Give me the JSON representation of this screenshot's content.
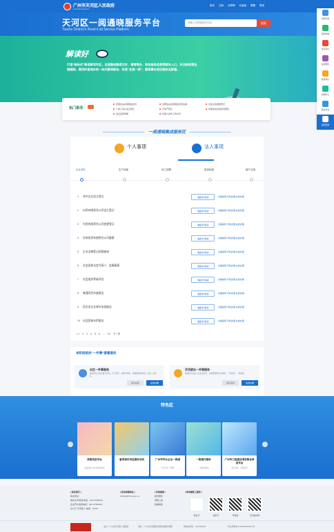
{
  "header": {
    "gov_name": "广州市天河区人民政府",
    "gov_sub": "www.thnet.gov.cn",
    "links": [
      "首页",
      "注册",
      "无障碍",
      "长者版",
      "繁體",
      "登录"
    ]
  },
  "hero": {
    "title": "天河区一阅通晓服务平台",
    "subtitle": "Tianhe District's  Read it all  Service Platform",
    "search_placeholder": "请输入您想搜索的内容",
    "search_button": "搜索"
  },
  "banner": {
    "badge": "解读好",
    "desc": "打造“新标式”解读事项专区，全面集成解读文件、请常等办、政务服务信息等服务入口，关注新政策全程跟踪、提供好查询办的一站式解读服务，实现“全程一网”，解读事办前后服务全都管。"
  },
  "hot": {
    "label": "热门事项",
    "items": [
      "存量住房买卖网签合同",
      "存量住房买卖网签合同注销",
      "企业社会保险登记",
      "个体工商户设立登记",
      "不动产登记",
      "存量住房买卖合同网签",
      "企业名称申报",
      "外国人来华工作许可"
    ]
  },
  "section": {
    "heading": "一阅通晓集成服务区",
    "tabs": [
      "个人事项",
      "法人事项"
    ],
    "steps": [
      "企业开办",
      "生产经营",
      "用工招聘",
      "投资经营",
      "破产注销"
    ]
  },
  "rows": [
    {
      "num": "1",
      "name": "合伙企业设立登记"
    },
    {
      "num": "2",
      "name": "内资有限责任公司设立登记"
    },
    {
      "num": "3",
      "name": "内资有限责任公司变更登记"
    },
    {
      "num": "4",
      "name": "外商投资有限责任公司备案"
    },
    {
      "num": "5",
      "name": "企业法律登记档案查询"
    },
    {
      "num": "6",
      "name": "社会团体法定代表人、监事备案"
    },
    {
      "num": "7",
      "name": "社会组织等级评估"
    },
    {
      "num": "8",
      "name": "普通项目年度报告"
    },
    {
      "num": "9",
      "name": "民办非企业单位年度报告"
    },
    {
      "num": "10",
      "name": "社会团体年检报告"
    }
  ],
  "row_labels": {
    "btn": "“做起式”解读",
    "acts": "办事指南  手机办理  在线办理"
  },
  "pager": [
    "< 1",
    "2",
    "3",
    "4",
    "5",
    "6",
    "...",
    "10",
    "下一页"
  ],
  "guide": {
    "title": "本阶段相关“一件事”套餐服务",
    "cards": [
      {
        "title": "出生一件事服务",
        "desc": "集成新生儿出生医学证明、户口登记、社保卡申领、医保参保等事项，实现一次办好。",
        "b1": "服务指南",
        "b2": "在线办理"
      },
      {
        "title": "灵活就业一件事服务",
        "desc": "集成灵活就业人员就业登记、社保参保登记等事项，一表申请，一网通办。",
        "b1": "服务指南",
        "b2": "在线办理"
      }
    ]
  },
  "feature": {
    "title": "特色区",
    "cards": [
      {
        "title": "政策找您平台",
        "sub": "政策找您-为企业解读扶持"
      },
      {
        "title": "看得清天河区服务与码",
        "sub": ""
      },
      {
        "title": "广州市开办企业一网通",
        "sub": "开办企业一网通"
      },
      {
        "title": "一照通行服务",
        "sub": "一照通行服务"
      },
      {
        "title": "广州市工程建设项目联合审批平台",
        "sub": "联合审批、并联审批"
      }
    ]
  },
  "footer": {
    "contact_title": "[ 联系我们 ]",
    "contact": [
      "联系地址：",
      "联系方式/联系电话：020-37586319",
      "企业开办监督电话：020-37586319",
      "办公厅 天河区人 电话：12345"
    ],
    "email_title": "[ 联系邮箱地址 ]",
    "email": "thzwfw@thnet.gov.cn",
    "links_title": "[ 其他链接 ]",
    "links": [
      "政务服务",
      "通知公告",
      "政策解读"
    ],
    "qr_title": "[ 移动端掌上服务 ]",
    "qr_labels": [
      "微信号",
      "服务号",
      "粤省事",
      "天河政务网"
    ],
    "bottom": [
      "主办：广州市天河区人民政府",
      "承办：广州市天河区政务服务数据管理局",
      "网站标识码：4401060003",
      "粤公网安备 44010602000001号"
    ]
  },
  "sidebar": [
    "智能咨询",
    "我的办事",
    "投诉评价",
    "在线预约",
    "效果评价",
    "帮助中心",
    "联系方式",
    "返回顶部"
  ]
}
